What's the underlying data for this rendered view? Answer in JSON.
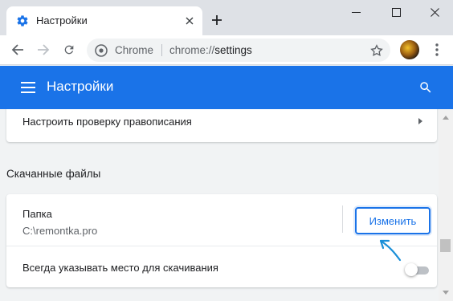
{
  "browser": {
    "tab": {
      "title": "Настройки",
      "favicon": "gear-icon",
      "close_icon": "close-icon"
    },
    "new_tab_icon": "plus-icon",
    "window_controls": [
      "minimize-icon",
      "maximize-icon",
      "close-icon"
    ],
    "toolbar": {
      "back_icon": "back-arrow-icon",
      "forward_icon": "forward-arrow-icon",
      "reload_icon": "reload-icon",
      "omnibox": {
        "site_label": "Chrome",
        "url_scheme": "chrome://",
        "url_host": "settings"
      },
      "bookmark_icon": "star-icon",
      "menu_icon": "more-vert-icon"
    }
  },
  "settings_header": {
    "title": "Настройки",
    "menu_icon": "hamburger-icon",
    "search_icon": "search-icon",
    "color": "#1a73e8"
  },
  "spellcheck_row": {
    "label": "Настроить проверку правописания"
  },
  "downloads": {
    "section_title": "Скачанные файлы",
    "folder_label": "Папка",
    "folder_path": "C:\\remontka.pro",
    "change_button": "Изменить",
    "ask_location_label": "Всегда указывать место для скачивания",
    "ask_location_enabled": false
  }
}
